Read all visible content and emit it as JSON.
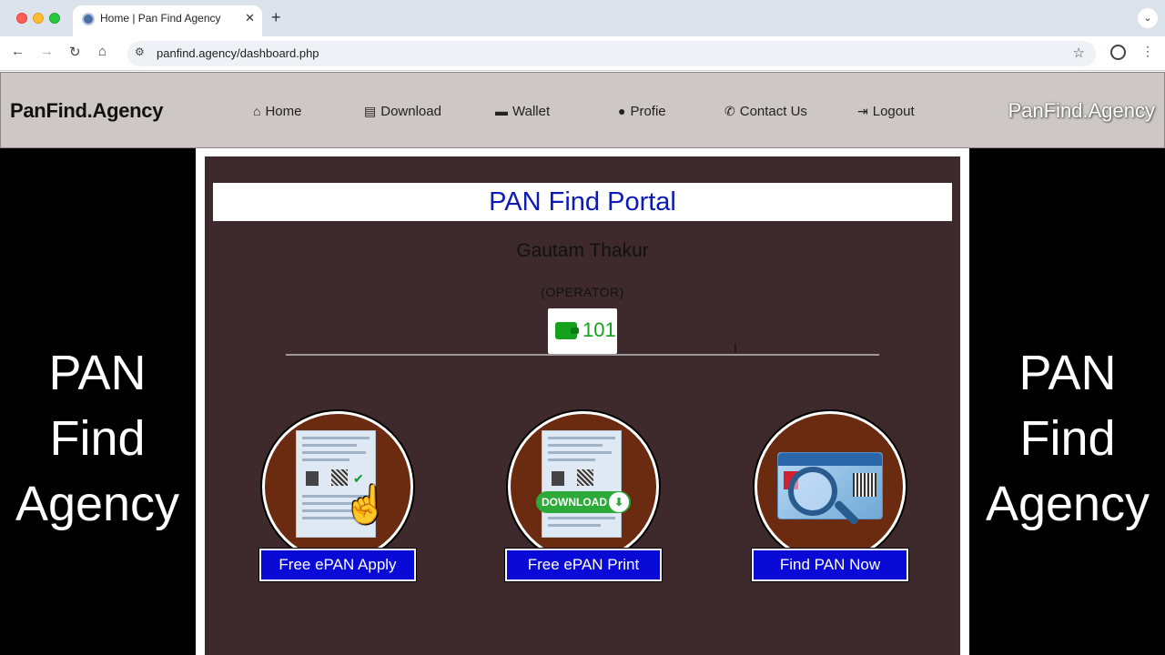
{
  "browser": {
    "tab_title": "Home | Pan Find Agency",
    "url": "panfind.agency/dashboard.php",
    "new_tab_icon": "plus-icon"
  },
  "site": {
    "brand": "PanFind.Agency",
    "brand_right": "PanFind.Agency",
    "nav": [
      {
        "label": "Home",
        "icon": "home-icon"
      },
      {
        "label": "Download",
        "icon": "file-download-icon"
      },
      {
        "label": "Wallet",
        "icon": "wallet-icon"
      },
      {
        "label": "Profie",
        "icon": "user-icon"
      },
      {
        "label": "Contact Us",
        "icon": "whatsapp-icon"
      },
      {
        "label": "Logout",
        "icon": "logout-icon"
      }
    ],
    "side_text": [
      "PAN",
      "Find",
      "Agency"
    ]
  },
  "dashboard": {
    "portal_title": "PAN Find Portal",
    "user_name": "Gautam Thakur",
    "user_role": "(OPERATOR)",
    "wallet_balance": "101",
    "services": [
      {
        "label": "Free ePAN Apply"
      },
      {
        "label": "Free ePAN Print",
        "badge": "DOWNLOAD"
      },
      {
        "label": "Find PAN Now"
      }
    ]
  },
  "colors": {
    "portal_title": "#0c1ab8",
    "service_button": "#0a0ad6",
    "wallet": "#14a21c",
    "panel": "#3e2a2c",
    "nav_bar": "#cdc7c7"
  }
}
